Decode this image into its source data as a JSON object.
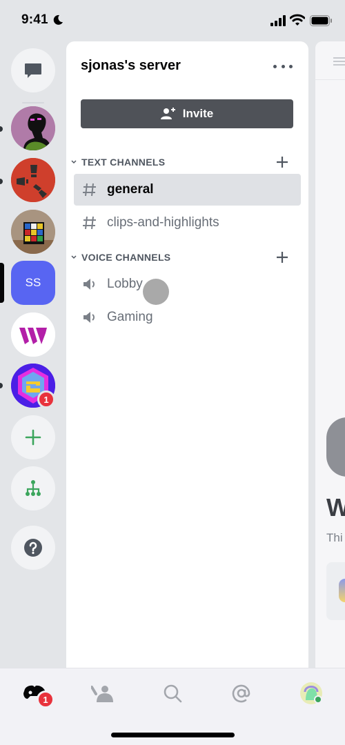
{
  "status_bar": {
    "time": "9:41",
    "focus_icon": "moon-icon",
    "signal_icon": "cellular-signal-icon",
    "wifi_icon": "wifi-icon",
    "battery_icon": "battery-icon"
  },
  "server_rail": {
    "direct_messages_icon": "chat-bubble-icon",
    "servers": [
      {
        "name": "server-enderman",
        "has_unread_dot": true
      },
      {
        "name": "server-rust",
        "has_unread_dot": true
      },
      {
        "name": "server-rubiks-cube",
        "has_unread_dot": false
      },
      {
        "name": "sjonas's server",
        "initials": "SS",
        "selected": true,
        "color": "#5865f2"
      },
      {
        "name": "server-w-logo",
        "has_unread_dot": false
      },
      {
        "name": "server-hexagon",
        "has_unread_dot": true,
        "mention_badge": "1"
      }
    ],
    "add_server_icon": "plus-icon",
    "explore_icon": "hierarchy-icon",
    "help_icon": "question-icon"
  },
  "channel_panel": {
    "server_name": "sjonas's server",
    "more_icon": "more-horizontal-icon",
    "invite_label": "Invite",
    "categories": [
      {
        "label": "TEXT CHANNELS",
        "channels": [
          {
            "name": "general",
            "type": "text",
            "selected": true
          },
          {
            "name": "clips-and-highlights",
            "type": "text",
            "selected": false
          }
        ]
      },
      {
        "label": "VOICE CHANNELS",
        "channels": [
          {
            "name": "Lobby",
            "type": "voice",
            "selected": false
          },
          {
            "name": "Gaming",
            "type": "voice",
            "selected": false
          }
        ]
      }
    ]
  },
  "peek_panel": {
    "title_fragment": "W",
    "subtitle_fragment": "Thi"
  },
  "tab_bar": {
    "tabs": [
      {
        "name": "home",
        "icon": "discord-home-icon",
        "badge": "1",
        "active": true
      },
      {
        "name": "friends",
        "icon": "friends-icon",
        "active": false
      },
      {
        "name": "search",
        "icon": "search-icon",
        "active": false
      },
      {
        "name": "mentions",
        "icon": "at-sign-icon",
        "active": false
      },
      {
        "name": "profile",
        "icon": "user-avatar-icon",
        "active": false
      }
    ]
  },
  "colors": {
    "brand": "#5865f2",
    "badge_red": "#e8323c",
    "green": "#3ba55c",
    "rail_bg": "#e3e5e8"
  }
}
